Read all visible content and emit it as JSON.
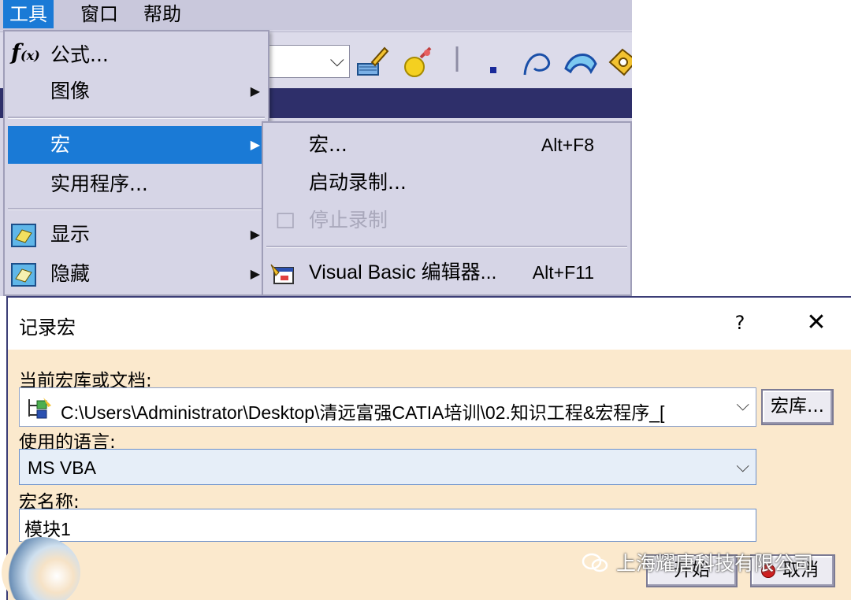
{
  "menubar": {
    "items": [
      "工具",
      "窗口",
      "帮助"
    ],
    "active_index": 0
  },
  "toolbar": {
    "combo_text": "",
    "icons": [
      "brush-tool-icon",
      "sphere-sparkle-icon",
      "point-icon",
      "spline-icon",
      "curve-icon",
      "gear-box-icon"
    ]
  },
  "tools_menu": {
    "items": [
      {
        "label": "公式...",
        "icon": "formula-icon",
        "submenu": false
      },
      {
        "label": "图像",
        "submenu": true
      },
      {
        "label": "宏",
        "submenu": true,
        "highlighted": true
      },
      {
        "label": "实用程序...",
        "submenu": false
      },
      {
        "label": "显示",
        "icon": "show-icon",
        "submenu": true
      },
      {
        "label": "隐藏",
        "icon": "hide-icon",
        "submenu": true
      }
    ]
  },
  "macro_submenu": {
    "items": [
      {
        "label": "宏...",
        "shortcut": "Alt+F8"
      },
      {
        "label": "启动录制...",
        "shortcut": ""
      },
      {
        "label": "停止录制",
        "shortcut": "",
        "disabled": true
      },
      {
        "label": "Visual Basic 编辑器...",
        "shortcut": "Alt+F11",
        "icon": "vb-editor-icon"
      }
    ]
  },
  "dialog": {
    "title": "记录宏",
    "help_label": "?",
    "close_label": "✕",
    "library_label": "当前宏库或文档:",
    "library_value": "C:\\Users\\Administrator\\Desktop\\清远富强CATIA培训\\02.知识工程&宏程序_[",
    "library_button": "宏库...",
    "language_label": "使用的语言:",
    "language_value": "MS VBA",
    "name_label": "宏名称:",
    "name_value": "模块1",
    "start_button": "开始",
    "cancel_button": "取消"
  },
  "watermark": "上海耀唐科技有限公司",
  "colors": {
    "highlight": "#1a7ad6",
    "menu_bg": "#d6d5e6",
    "dialog_bg": "#fbe9cd",
    "title_strip": "#2e2f6a"
  }
}
